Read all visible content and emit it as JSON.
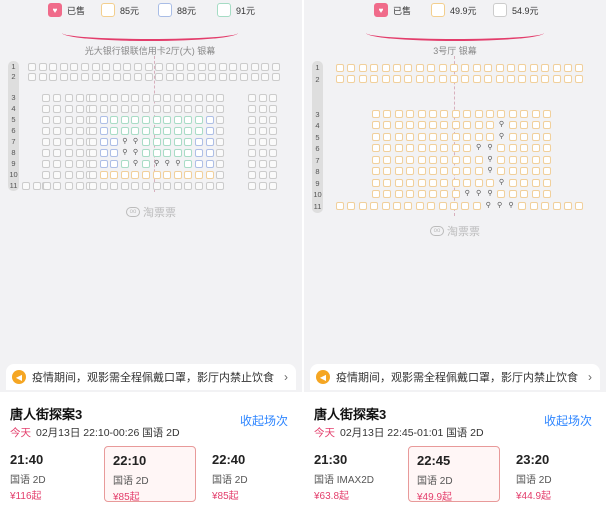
{
  "panels": [
    {
      "id": "left",
      "legend": {
        "sold_label": "已售",
        "prices": [
          {
            "label": "85元",
            "color": "#f1d09b"
          },
          {
            "label": "88元",
            "color": "#aebfe6"
          },
          {
            "label": "91元",
            "color": "#a9dcc6"
          }
        ]
      },
      "screen_label": "光大银行银联信用卡2厅(大) 银幕",
      "row_numbers": [
        "1",
        "2",
        "",
        "3",
        "4",
        "5",
        "6",
        "7",
        "8",
        "9",
        "10",
        "11"
      ],
      "watermark": "淘票票",
      "notice": "疫情期间，观影需全程佩戴口罩，影厅内禁止饮食",
      "movie_title": "唐人街探案3",
      "collapse_label": "收起场次",
      "today_label": "今天",
      "date_text": "02月13日 22:10-00:26 国语 2D",
      "sessions": [
        {
          "time": "21:40",
          "lang": "国语 2D",
          "price": "¥116起",
          "selected": false
        },
        {
          "time": "22:10",
          "lang": "国语 2D",
          "price": "¥85起",
          "selected": true
        },
        {
          "time": "22:40",
          "lang": "国语 2D",
          "price": "¥85起",
          "selected": false
        }
      ]
    },
    {
      "id": "right",
      "legend": {
        "sold_label": "已售",
        "prices": [
          {
            "label": "49.9元",
            "color": "#f1d09b"
          },
          {
            "label": "54.9元",
            "color": "#cccccc"
          }
        ]
      },
      "screen_label": "3号厅 银幕",
      "row_numbers": [
        "1",
        "2",
        "",
        "3",
        "4",
        "5",
        "6",
        "7",
        "8",
        "9",
        "10",
        "11"
      ],
      "watermark": "淘票票",
      "notice": "疫情期间，观影需全程佩戴口罩，影厅内禁止饮食",
      "movie_title": "唐人街探案3",
      "collapse_label": "收起场次",
      "today_label": "今天",
      "date_text": "02月13日 22:45-01:01 国语 2D",
      "sessions": [
        {
          "time": "21:30",
          "lang": "国语 IMAX2D",
          "price": "¥63.8起",
          "selected": false
        },
        {
          "time": "22:45",
          "lang": "国语 2D",
          "price": "¥49.9起",
          "selected": true
        },
        {
          "time": "23:20",
          "lang": "国语 2D",
          "price": "¥44.9起",
          "selected": false
        }
      ]
    }
  ],
  "icons": {
    "sold": "heart-ticket-icon",
    "notice": "speaker-icon",
    "chevron": "chevron-right-icon",
    "watermark": "taopiaopiao-logo-icon"
  }
}
